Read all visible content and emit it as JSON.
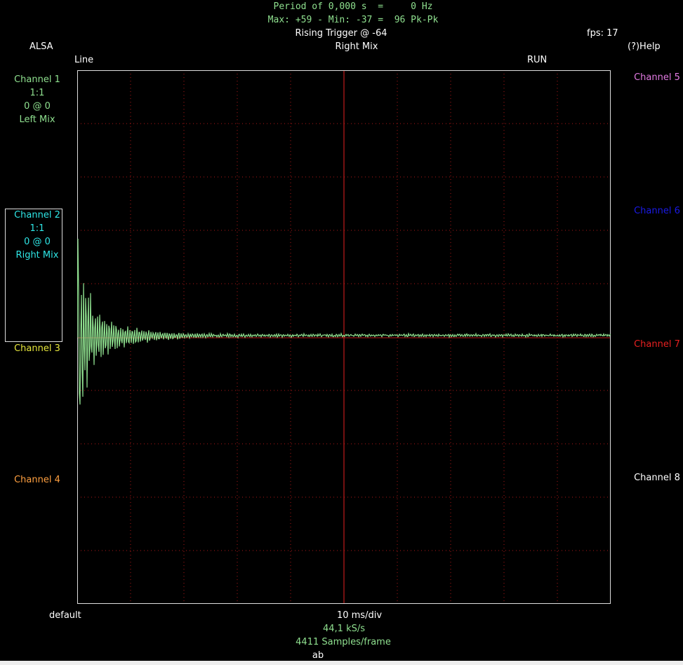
{
  "header": {
    "period_line": "Period of 0,000 s  =     0 Hz",
    "maxmin_line": "Max: +59 - Min: -37 =  96 Pk-Pk",
    "trigger": "Rising Trigger @ -64",
    "fps": "fps: 17",
    "source": "ALSA",
    "trigger_channel": "Right Mix",
    "help": "(?)Help",
    "input_line": "Line",
    "run_state": "RUN"
  },
  "channels_left": [
    {
      "name": "Channel 1",
      "scale": "1:1",
      "pos": "0 @ 0",
      "source": "Left Mix",
      "color": "#8fe08f"
    },
    {
      "name": "Channel 2",
      "scale": "1:1",
      "pos": "0 @ 0",
      "source": "Right Mix",
      "color": "#2ee6e6"
    },
    {
      "name": "Channel 3",
      "color": "#e6e63c"
    },
    {
      "name": "Channel 4",
      "color": "#ffa040"
    }
  ],
  "channels_right": [
    {
      "name": "Channel 5",
      "color": "#e27ae2"
    },
    {
      "name": "Channel 6",
      "color": "#1a1ae6"
    },
    {
      "name": "Channel 7",
      "color": "#e62020"
    },
    {
      "name": "Channel 8",
      "color": "#ffffff"
    }
  ],
  "footer": {
    "preset": "default",
    "timebase": "10 ms/div",
    "sample_rate": "44,1 kS/s",
    "samples": "4411 Samples/frame",
    "keys": "ab"
  },
  "colors": {
    "grid": "#b01818",
    "trace": "#8fe08f",
    "header_green": "#8fe08f",
    "border": "#dddddd"
  }
}
